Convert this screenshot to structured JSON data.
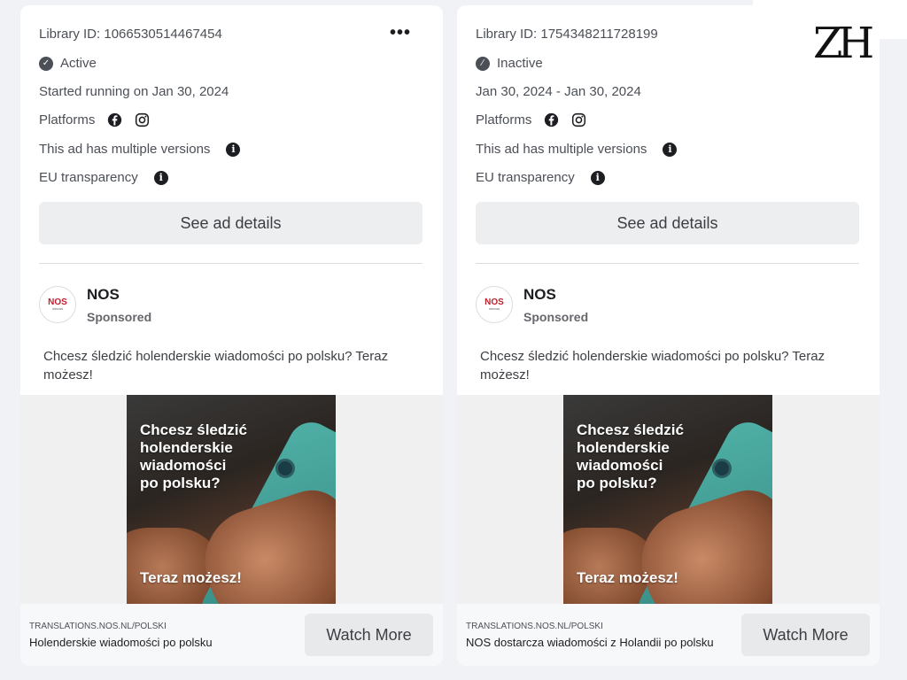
{
  "watermark": "ZH",
  "cards": [
    {
      "library_id": "Library ID: 1066530514467454",
      "status": "Active",
      "status_icon": "check-circle-icon",
      "run_dates": "Started running on Jan 30, 2024",
      "platforms_label": "Platforms",
      "platform_icons": [
        "facebook-icon",
        "instagram-icon"
      ],
      "multiple_versions": "This ad has multiple versions",
      "eu_transparency": "EU transparency",
      "more_label": "•••",
      "details_button": "See ad details",
      "advertiser": {
        "name": "NOS",
        "avatar_text": "NOS",
        "avatar_subtext": "nieuws",
        "sponsored": "Sponsored"
      },
      "ad_text": "Chcesz śledzić holenderskie wiadomości po polsku? Teraz możesz!",
      "creative": {
        "headline": "Chcesz śledzić\nholenderskie\nwiadomości\npo polsku?",
        "tagline": "Teraz możesz!"
      },
      "footer": {
        "domain": "TRANSLATIONS.NOS.NL/POLSKI",
        "description": "Holenderskie wiadomości po polsku",
        "cta": "Watch More"
      }
    },
    {
      "library_id": "Library ID: 1754348211728199",
      "status": "Inactive",
      "status_icon": "slash-circle-icon",
      "run_dates": "Jan 30, 2024 - Jan 30, 2024",
      "platforms_label": "Platforms",
      "platform_icons": [
        "facebook-icon",
        "instagram-icon"
      ],
      "multiple_versions": "This ad has multiple versions",
      "eu_transparency": "EU transparency",
      "details_button": "See ad details",
      "advertiser": {
        "name": "NOS",
        "avatar_text": "NOS",
        "avatar_subtext": "nieuws",
        "sponsored": "Sponsored"
      },
      "ad_text": "Chcesz śledzić holenderskie wiadomości po polsku? Teraz możesz!",
      "creative": {
        "headline": "Chcesz śledzić\nholenderskie\nwiadomości\npo polsku?",
        "tagline": "Teraz możesz!"
      },
      "footer": {
        "domain": "TRANSLATIONS.NOS.NL/POLSKI",
        "description": "NOS dostarcza wiadomości z Holandii po polsku",
        "cta": "Watch More"
      }
    }
  ]
}
